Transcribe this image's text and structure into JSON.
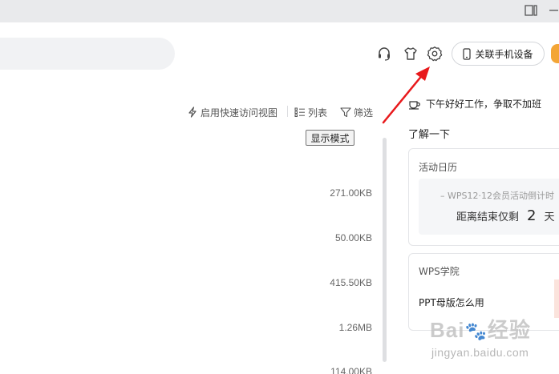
{
  "header": {
    "connect_phone_label": "关联手机设备",
    "icons": [
      "headset-icon",
      "skin-icon",
      "settings-icon"
    ]
  },
  "toolbar": {
    "quick_view_label": "启用快速访问视图",
    "list_label": "列表",
    "filter_label": "筛选",
    "display_mode_tooltip": "显示模式"
  },
  "files": {
    "sizes": [
      "271.00KB",
      "50.00KB",
      "415.50KB",
      "1.26MB",
      "114.00KB"
    ]
  },
  "side_panel": {
    "greeting": "下午好好工作，争取不加班",
    "learn_more": "了解一下",
    "activity_card": {
      "title": "活动日历",
      "event": "– WPS12·12会员活动倒计时",
      "countdown_prefix": "距离结束仅剩",
      "countdown_value": "2",
      "countdown_unit": "天"
    },
    "academy_card": {
      "title": "WPS学院",
      "item": "PPT母版怎么用"
    }
  },
  "watermark": {
    "brand": "Bai",
    "brand_suffix": "经验",
    "url": "jingyan.baidu.com"
  },
  "colors": {
    "arrow": "#e8191c",
    "avatar": "#f3a536",
    "titlebar": "#e9eaec"
  }
}
